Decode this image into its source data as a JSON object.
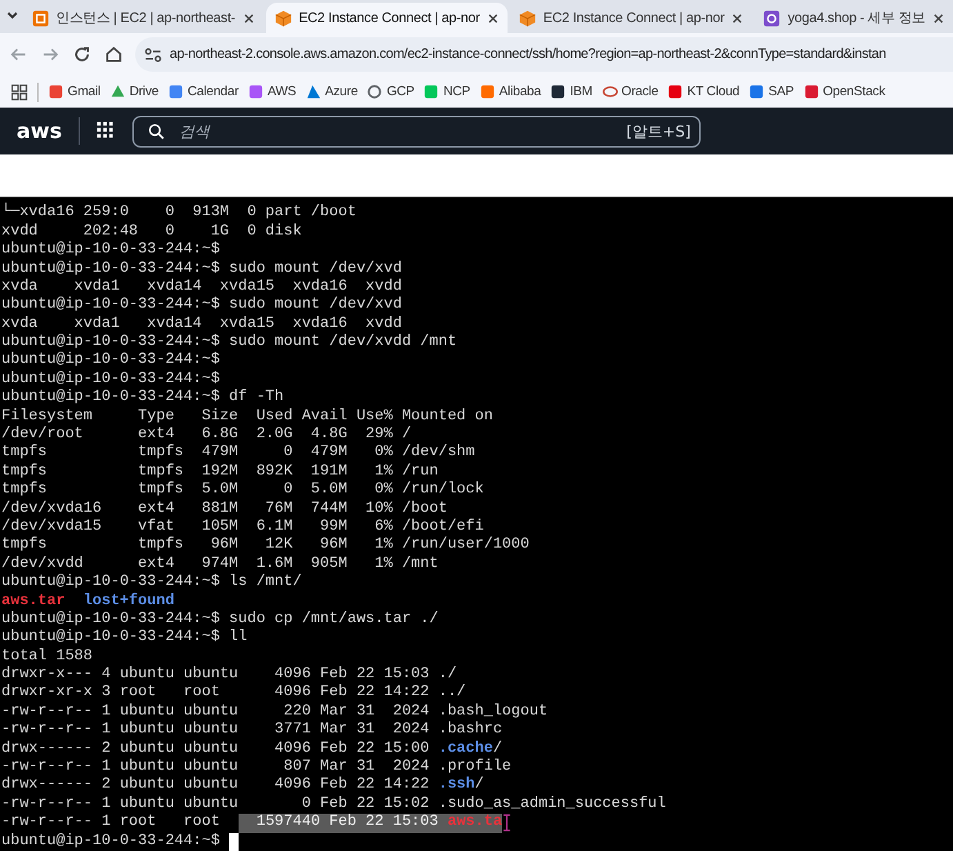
{
  "tabs": [
    {
      "label": "인스턴스 | EC2 | ap-northeast-",
      "selected": false
    },
    {
      "label": "EC2 Instance Connect | ap-nor",
      "selected": true
    },
    {
      "label": "EC2 Instance Connect | ap-nor",
      "selected": false
    },
    {
      "label": "yoga4.shop - 세부 정보",
      "selected": false
    }
  ],
  "address_bar": {
    "url": "ap-northeast-2.console.aws.amazon.com/ec2-instance-connect/ssh/home?region=ap-northeast-2&connType=standard&instan"
  },
  "bookmarks": [
    {
      "label": "Gmail"
    },
    {
      "label": "Drive"
    },
    {
      "label": "Calendar"
    },
    {
      "label": "AWS"
    },
    {
      "label": "Azure"
    },
    {
      "label": "GCP"
    },
    {
      "label": "NCP"
    },
    {
      "label": "Alibaba"
    },
    {
      "label": "IBM"
    },
    {
      "label": "Oracle"
    },
    {
      "label": "KT Cloud"
    },
    {
      "label": "SAP"
    },
    {
      "label": "OpenStack"
    }
  ],
  "aws_header": {
    "logo": "aws",
    "search": {
      "placeholder": "검색"
    },
    "shortcut": "[알트+S]"
  },
  "terminal": {
    "lines": [
      {
        "segments": [
          {
            "kind": "plain",
            "text": "└─xvda16 259:0    0  913M  0 part /boot"
          }
        ]
      },
      {
        "segments": [
          {
            "kind": "plain",
            "text": "xvdd     202:48   0    1G  0 disk"
          }
        ]
      },
      {
        "segments": [
          {
            "kind": "plain",
            "text": "ubuntu@ip-10-0-33-244:~$"
          }
        ]
      },
      {
        "segments": [
          {
            "kind": "plain",
            "text": "ubuntu@ip-10-0-33-244:~$ sudo mount /dev/xvd"
          }
        ]
      },
      {
        "segments": [
          {
            "kind": "plain",
            "text": "xvda    xvda1   xvda14  xvda15  xvda16  xvdd"
          }
        ]
      },
      {
        "segments": [
          {
            "kind": "plain",
            "text": "ubuntu@ip-10-0-33-244:~$ sudo mount /dev/xvd"
          }
        ]
      },
      {
        "segments": [
          {
            "kind": "plain",
            "text": "xvda    xvda1   xvda14  xvda15  xvda16  xvdd"
          }
        ]
      },
      {
        "segments": [
          {
            "kind": "plain",
            "text": "ubuntu@ip-10-0-33-244:~$ sudo mount /dev/xvdd /mnt"
          }
        ]
      },
      {
        "segments": [
          {
            "kind": "plain",
            "text": "ubuntu@ip-10-0-33-244:~$"
          }
        ]
      },
      {
        "segments": [
          {
            "kind": "plain",
            "text": "ubuntu@ip-10-0-33-244:~$"
          }
        ]
      },
      {
        "segments": [
          {
            "kind": "plain",
            "text": "ubuntu@ip-10-0-33-244:~$ df -Th"
          }
        ]
      },
      {
        "segments": [
          {
            "kind": "plain",
            "text": "Filesystem     Type   Size  Used Avail Use% Mounted on"
          }
        ]
      },
      {
        "segments": [
          {
            "kind": "plain",
            "text": "/dev/root      ext4   6.8G  2.0G  4.8G  29% /"
          }
        ]
      },
      {
        "segments": [
          {
            "kind": "plain",
            "text": "tmpfs          tmpfs  479M     0  479M   0% /dev/shm"
          }
        ]
      },
      {
        "segments": [
          {
            "kind": "plain",
            "text": "tmpfs          tmpfs  192M  892K  191M   1% /run"
          }
        ]
      },
      {
        "segments": [
          {
            "kind": "plain",
            "text": "tmpfs          tmpfs  5.0M     0  5.0M   0% /run/lock"
          }
        ]
      },
      {
        "segments": [
          {
            "kind": "plain",
            "text": "/dev/xvda16    ext4   881M   76M  744M  10% /boot"
          }
        ]
      },
      {
        "segments": [
          {
            "kind": "plain",
            "text": "/dev/xvda15    vfat   105M  6.1M   99M   6% /boot/efi"
          }
        ]
      },
      {
        "segments": [
          {
            "kind": "plain",
            "text": "tmpfs          tmpfs   96M   12K   96M   1% /run/user/1000"
          }
        ]
      },
      {
        "segments": [
          {
            "kind": "plain",
            "text": "/dev/xvdd      ext4   974M  1.6M  905M   1% /mnt"
          }
        ]
      },
      {
        "segments": [
          {
            "kind": "plain",
            "text": "ubuntu@ip-10-0-33-244:~$ ls /mnt/"
          }
        ]
      },
      {
        "segments": [
          {
            "kind": "archive",
            "text": "aws.tar"
          },
          {
            "kind": "dir",
            "text": "lost+found"
          }
        ]
      },
      {
        "segments": [
          {
            "kind": "plain",
            "text": "ubuntu@ip-10-0-33-244:~$ sudo cp /mnt/aws.tar ./"
          }
        ]
      },
      {
        "segments": [
          {
            "kind": "plain",
            "text": "ubuntu@ip-10-0-33-244:~$ ll"
          }
        ]
      },
      {
        "segments": [
          {
            "kind": "plain",
            "text": "total 1588"
          }
        ]
      },
      {
        "segments": [
          {
            "kind": "plain",
            "text": "drwxr-x--- 4 ubuntu ubuntu    4096 Feb 22 15:03 ./"
          }
        ]
      },
      {
        "segments": [
          {
            "kind": "plain",
            "text": "drwxr-xr-x 3 root   root      4096 Feb 22 14:22 ../"
          }
        ]
      },
      {
        "segments": [
          {
            "kind": "plain",
            "text": "-rw-r--r-- 1 ubuntu ubuntu     220 Mar 31  2024 .bash_logout"
          }
        ]
      },
      {
        "segments": [
          {
            "kind": "plain",
            "text": "-rw-r--r-- 1 ubuntu ubuntu    3771 Mar 31  2024 .bashrc"
          }
        ]
      },
      {
        "segments": [
          {
            "kind": "plain",
            "text": "drwx------ 2 ubuntu ubuntu    4096 Feb 22 15:00 "
          },
          {
            "kind": "dir",
            "text": ".cache"
          },
          {
            "kind": "plain",
            "text": "/"
          }
        ]
      },
      {
        "segments": [
          {
            "kind": "plain",
            "text": "-rw-r--r-- 1 ubuntu ubuntu     807 Mar 31  2024 .profile"
          }
        ]
      },
      {
        "segments": [
          {
            "kind": "plain",
            "text": "drwx------ 2 ubuntu ubuntu    4096 Feb 22 14:22 "
          },
          {
            "kind": "dir",
            "text": ".ssh"
          },
          {
            "kind": "plain",
            "text": "/"
          }
        ]
      },
      {
        "segments": [
          {
            "kind": "plain",
            "text": "-rw-r--r-- 1 ubuntu ubuntu       0 Feb 22 15:02 .sudo_as_admin_successful"
          }
        ]
      },
      {
        "segments": [
          {
            "kind": "plain",
            "text": "-rw-r--r-- 1 root   root  "
          },
          {
            "kind": "selected",
            "text": "  1597440 Feb 22 15:03 "
          },
          {
            "kind": "selected-archive",
            "text": "aws.ta"
          }
        ],
        "mouse_cursor": true
      },
      {
        "segments": [
          {
            "kind": "plain",
            "text": "ubuntu@ip-10-0-33-244:~$ "
          }
        ],
        "cursor": true
      }
    ]
  }
}
